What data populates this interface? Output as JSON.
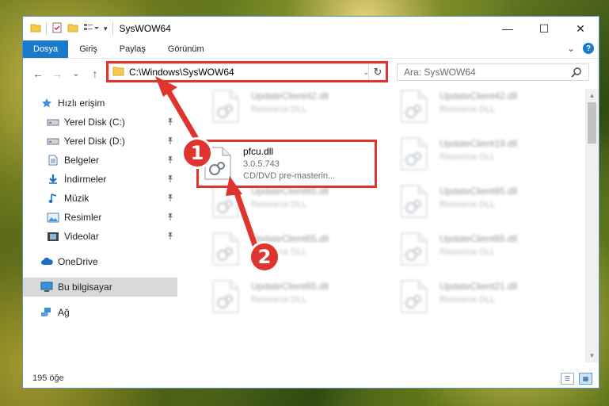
{
  "window": {
    "title": "SysWOW64",
    "minimize_glyph": "—",
    "maximize_glyph": "☐",
    "close_glyph": "✕"
  },
  "ribbon": {
    "tabs": [
      "Dosya",
      "Giriş",
      "Paylaş",
      "Görünüm"
    ],
    "expand_glyph": "⌄",
    "help_glyph": "?"
  },
  "nav": {
    "back_glyph": "←",
    "forward_glyph": "→",
    "recent_glyph": "⌄",
    "up_glyph": "↑",
    "address_path": "C:\\Windows\\SysWOW64",
    "address_dropdown_glyph": "⌄",
    "refresh_glyph": "↻",
    "search_placeholder": "Ara: SysWOW64"
  },
  "sidebar": {
    "quick_access": "Hızlı erişim",
    "items": [
      {
        "label": "Yerel Disk (C:)",
        "icon": "drive-icon",
        "pinned": true
      },
      {
        "label": "Yerel Disk (D:)",
        "icon": "drive-icon",
        "pinned": true
      },
      {
        "label": "Belgeler",
        "icon": "documents-icon",
        "pinned": true
      },
      {
        "label": "İndirmeler",
        "icon": "download-icon",
        "pinned": true
      },
      {
        "label": "Müzik",
        "icon": "music-icon",
        "pinned": true
      },
      {
        "label": "Resimler",
        "icon": "pictures-icon",
        "pinned": true
      },
      {
        "label": "Videolar",
        "icon": "videos-icon",
        "pinned": true
      }
    ],
    "onedrive": "OneDrive",
    "this_pc": "Bu bilgisayar",
    "network": "Ağ",
    "pin_glyph": "📌"
  },
  "files": {
    "highlighted": {
      "name": "pfcu.dll",
      "version": "3.0.5.743",
      "description": "CD/DVD pre-masterin..."
    },
    "blurred": [
      {
        "name": "UpdateClient42.dll",
        "type": "Resource DLL"
      },
      {
        "name": "UpdateClient42.dll",
        "type": "Resource DLL"
      },
      {
        "name": "UpdateClient19.dll",
        "type": "Resource DLL"
      },
      {
        "name": "UpdateClient65.dll",
        "type": "Resource DLL"
      },
      {
        "name": "UpdateClient65.dll",
        "type": "Resource DLL"
      },
      {
        "name": "UpdateClient65.dll",
        "type": "Resource DLL"
      },
      {
        "name": "UpdateClient65.dll",
        "type": "Resource DLL"
      },
      {
        "name": "UpdateClient65.dll",
        "type": "Resource DLL"
      },
      {
        "name": "UpdateClient21.dll",
        "type": "Resource DLL"
      }
    ]
  },
  "status": {
    "item_count": "195 öğe"
  },
  "annotations": {
    "step1": "1",
    "step2": "2",
    "color": "#e0342e"
  }
}
